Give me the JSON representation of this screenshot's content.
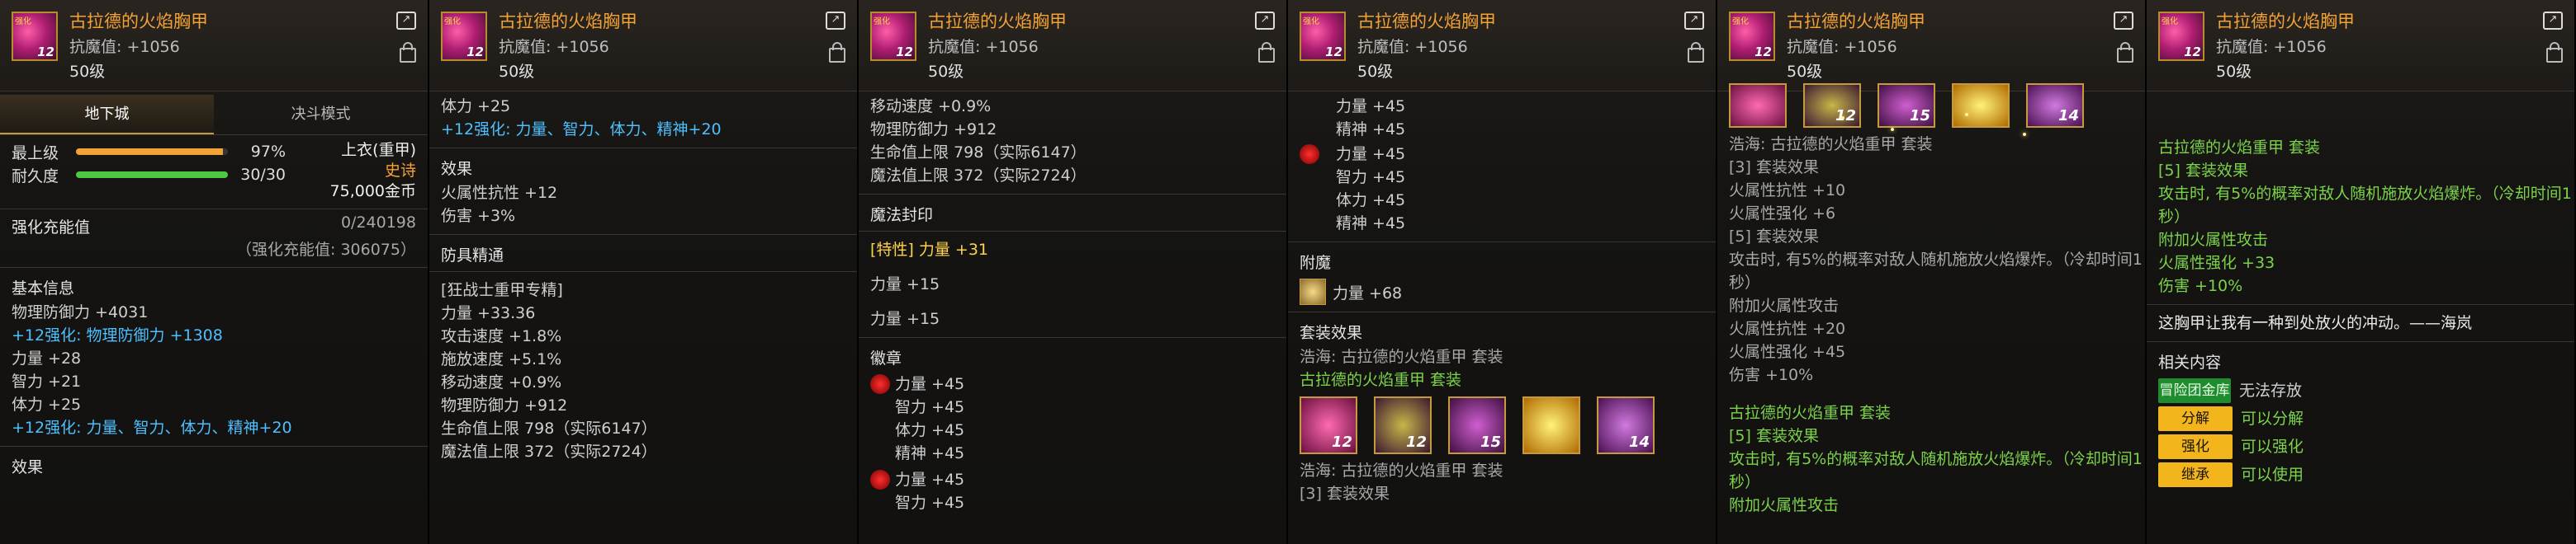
{
  "item": {
    "name": "古拉德的火焰胸甲",
    "resist": "抗魔值: +1056",
    "level": "50级",
    "icon_level": "12",
    "icon_tag": "强化"
  },
  "p1": {
    "tabs": [
      "地下城",
      "决斗模式"
    ],
    "bars": [
      {
        "label": "最上级",
        "value": "97%",
        "fill": 0.97,
        "color": "#f3a235"
      },
      {
        "label": "耐久度",
        "value": "30/30",
        "fill": 1.0,
        "color": "#4cc842"
      }
    ],
    "slot": "上衣(重甲)",
    "rarity": "史诗",
    "price": "75,000金币",
    "charge_title": "强化充能值",
    "charge_val": "0/240198",
    "charge_sub": "（强化充能值: 306075）",
    "basic_title": "基本信息",
    "lines": [
      {
        "t": "物理防御力 +4031",
        "c": ""
      },
      {
        "t": "+12强化: 物理防御力 +1308",
        "c": "blue"
      },
      {
        "t": "力量 +28",
        "c": ""
      },
      {
        "t": "智力 +21",
        "c": ""
      },
      {
        "t": "体力 +25",
        "c": ""
      },
      {
        "t": "+12强化: 力量、智力、体力、精神+20",
        "c": "blue"
      }
    ],
    "effect_title": "效果"
  },
  "p2": {
    "top": [
      {
        "t": "体力 +25",
        "c": ""
      },
      {
        "t": "+12强化: 力量、智力、体力、精神+20",
        "c": "blue"
      }
    ],
    "effect_title": "效果",
    "effect": [
      "火属性抗性 +12",
      "伤害 +3%"
    ],
    "mastery_title": "防具精通",
    "mastery": [
      "[狂战士重甲专精]",
      "力量 +33.36",
      "攻击速度 +1.8%",
      "施放速度 +5.1%",
      "移动速度 +0.9%",
      "物理防御力 +912",
      "生命值上限 798（实际6147）",
      "魔法值上限 372（实际2724）"
    ]
  },
  "p3": {
    "top": [
      "移动速度 +0.9%",
      "物理防御力 +912",
      "生命值上限 798（实际6147）",
      "魔法值上限 372（实际2724）"
    ],
    "seal_title": "魔法封印",
    "seal_main": "[特性] 力量 +31",
    "seal_lines": [
      "力量 +15",
      "力量 +15"
    ],
    "emblem_title": "徽章",
    "emblem1": [
      "力量 +45",
      "智力 +45",
      "体力 +45",
      "精神 +45"
    ],
    "emblem2": [
      "力量 +45",
      "智力 +45"
    ]
  },
  "p4": {
    "top": [
      "力量 +45",
      "精神 +45"
    ],
    "emblem": [
      "力量 +45",
      "智力 +45",
      "体力 +45",
      "精神 +45"
    ],
    "enchant_title": "附魔",
    "enchant": "力量 +68",
    "set_title": "套装效果",
    "set_line1": "浩海: 古拉德的火焰重甲  套装",
    "set_line2": "古拉德的火焰重甲  套装",
    "set_icons": [
      "12",
      "12",
      "15",
      "",
      "14"
    ],
    "set_line3": "浩海: 古拉德的火焰重甲  套装",
    "set_line4": "[3] 套装效果"
  },
  "p5": {
    "set_icons": [
      "",
      "12",
      "15",
      "",
      "14"
    ],
    "lines": [
      {
        "t": "浩海: 古拉德的火焰重甲  套装",
        "c": "gray"
      },
      {
        "t": "[3] 套装效果",
        "c": "gray"
      },
      {
        "t": "火属性抗性 +10",
        "c": "gray"
      },
      {
        "t": "火属性强化 +6",
        "c": "gray"
      },
      {
        "t": "[5] 套装效果",
        "c": "gray"
      },
      {
        "t": "攻击时, 有5%的概率对敌人随机施放火焰爆炸。（冷却时间1",
        "c": "gray"
      },
      {
        "t": "秒）",
        "c": "gray"
      },
      {
        "t": "附加火属性攻击",
        "c": "gray"
      },
      {
        "t": "火属性抗性 +20",
        "c": "gray"
      },
      {
        "t": "火属性强化 +45",
        "c": "gray"
      },
      {
        "t": "伤害 +10%",
        "c": "gray"
      }
    ],
    "set_name": "古拉德的火焰重甲  套装",
    "set5": "[5] 套装效果",
    "set5_desc1": "攻击时, 有5%的概率对敌人随机施放火焰爆炸。（冷却时间1",
    "set5_desc2": "秒）",
    "cut": "附加火属性攻击"
  },
  "p6": {
    "set_name": "古拉德的火焰重甲  套装",
    "set5": "[5] 套装效果",
    "desc1": "攻击时, 有5%的概率对敌人随机施放火焰爆炸。（冷却时间1",
    "desc2": "秒）",
    "add": "附加火属性攻击",
    "fire": "火属性强化 +33",
    "dmg": "伤害 +10%",
    "flavor": "这胸甲让我有一种到处放火的冲动。——海岚",
    "related_title": "相关内容",
    "related": [
      {
        "btn": "冒险团金库",
        "text": "无法存放",
        "green": true
      },
      {
        "btn": "分解",
        "text": "可以分解",
        "green": false
      },
      {
        "btn": "强化",
        "text": "可以强化",
        "green": false
      },
      {
        "btn": "继承",
        "text": "可以使用",
        "green": false
      }
    ]
  }
}
